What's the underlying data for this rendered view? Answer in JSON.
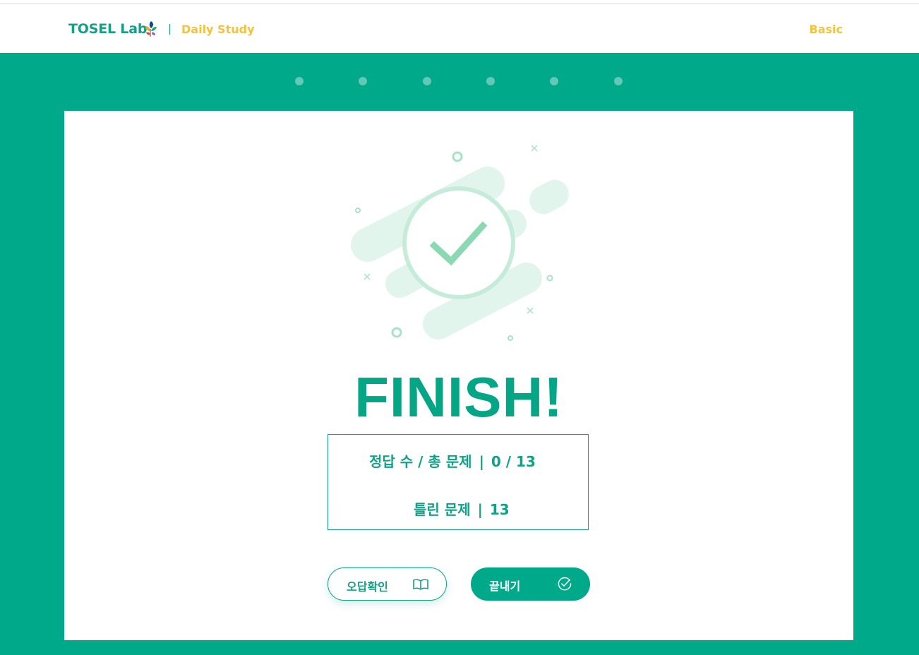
{
  "header": {
    "brand": "TOSEL Lab",
    "section": "Daily Study",
    "level": "Basic"
  },
  "progress_dots": {
    "count": 6
  },
  "result": {
    "title": "FINISH!",
    "correct_label": "정답 수 / 총 문제",
    "correct_value": "0 / 13",
    "wrong_label": "틀린 문제",
    "wrong_value": "13",
    "separator": "|"
  },
  "buttons": {
    "review_label": "오답확인",
    "finish_label": "끝내기"
  },
  "colors": {
    "primary": "#00a98a",
    "accent": "#f5c13e",
    "illustration_light": "#e2f5ec",
    "illustration_mid": "#8ad9b2"
  },
  "icons": {
    "brand_logo": "leaf-logo-icon",
    "illustration": "check-circle-icon",
    "review": "open-book-icon",
    "finish": "check-circle-small-icon"
  }
}
